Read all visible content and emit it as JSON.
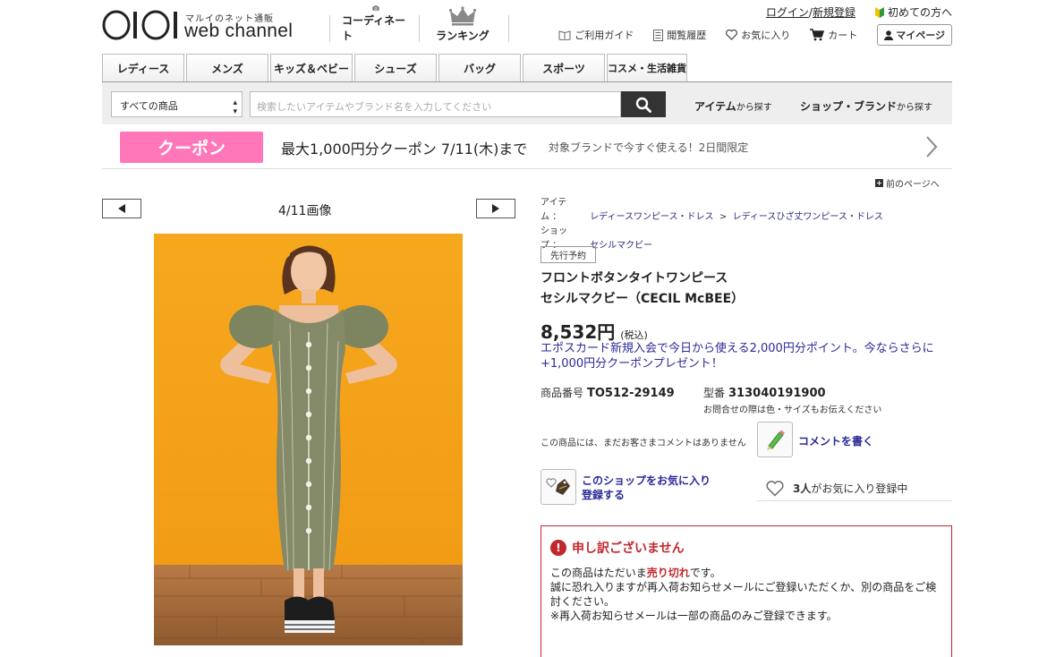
{
  "header": {
    "logo_tag": "マルイのネット通販",
    "logo_name": "web channel",
    "nav_coordinate": "コーディネート",
    "nav_ranking": "ランキング",
    "login": "ログイン",
    "slash": "/",
    "register": "新規登録",
    "beginner": "初めての方へ",
    "guide": "ご利用ガイド",
    "history": "閲覧履歴",
    "favorites": "お気に入り",
    "cart": "カート",
    "mypage": "マイページ"
  },
  "categories": [
    "レディース",
    "メンズ",
    "キッズ＆ベビー",
    "シューズ",
    "バッグ",
    "スポーツ",
    "コスメ・生活雑貨"
  ],
  "search": {
    "category_selected": "すべての商品",
    "placeholder": "検索したいアイテムやブランド名を入力してください",
    "by_item": "アイテム",
    "by_item_suffix": "から探す",
    "by_shop": "ショップ・ブランド",
    "by_shop_suffix": "から探す"
  },
  "coupon": {
    "badge": "クーポン",
    "text": "最大1,000円分クーポン 7/11(木)まで",
    "sub": "対象ブランドで今すぐ使える！2日間限定"
  },
  "back_link": "前のページへ",
  "gallery": {
    "counter": "4/11画像"
  },
  "breadcrumbs": {
    "item_key": "アイテム",
    "item_colon": "：",
    "item_path1": "レディースワンピース・ドレス",
    "item_sep": ">",
    "item_path2": "レディースひざ丈ワンピース・ドレス",
    "shop_key": "ショップ",
    "shop_colon": "：",
    "shop_name": "セシルマクビー"
  },
  "product": {
    "tag": "先行予約",
    "name": "フロントボタンタイトワンピース",
    "brand": "セシルマクビー（CECIL McBEE）",
    "price": "8,532円",
    "tax": "(税込)",
    "epos_line1": "エポスカード新規入会で今日から使える2,000円分ポイント。今ならさらに",
    "epos_line2": "+1,000円分クーポンプレゼント！",
    "code_label": "商品番号",
    "code": "TO512-29149",
    "model_label": "型番",
    "model": "313040191900",
    "inquiry": "お問合せの際は色・サイズもお伝えください",
    "no_comment": "この商品には、まだお客さまコメントはありません",
    "write_comment": "コメントを書く",
    "fav_shop_line1": "このショップをお気に入り",
    "fav_shop_line2": "登録する",
    "fav_count": "3人",
    "fav_count_suffix": "がお気に入り登録中"
  },
  "soldout": {
    "title": "申し訳ございません",
    "line1_a": "この商品はただいま",
    "line1_b": "売り切れ",
    "line1_c": "です。",
    "line2": "誠に恐れ入りますが再入荷お知らせメールにご登録いただくか、別の商品をご検",
    "line3": "討ください。",
    "line4": "※再入荷お知らせメールは一部の商品のみご登録できます。"
  },
  "colors": {
    "coupon_pink": "#ff77b8",
    "link_blue": "#2a2a9a",
    "alert_red": "#c0282d",
    "photo_bg": "#f4a51f"
  }
}
